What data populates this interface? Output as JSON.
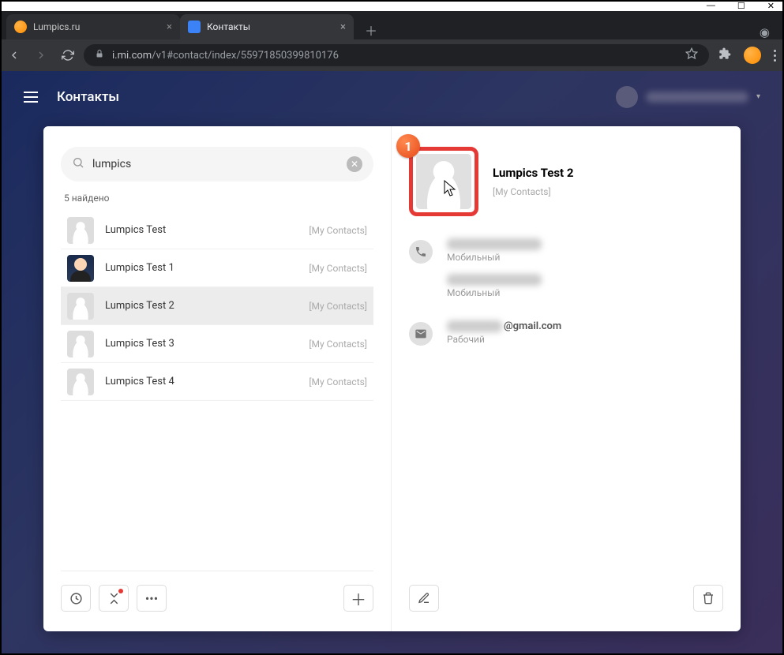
{
  "window": {
    "tabs": [
      {
        "title": "Lumpics.ru",
        "favicon": "orange",
        "active": false
      },
      {
        "title": "Контакты",
        "favicon": "blue",
        "active": true
      }
    ]
  },
  "urlbar": {
    "lock": "🔒",
    "host": "i.mi.com",
    "path": "/v1#contact/index/55971850399810176"
  },
  "app": {
    "title": "Контакты",
    "search_value": "lumpics",
    "found_label": "5 найдено",
    "contacts": [
      {
        "name": "Lumpics Test",
        "tag": "[My Contacts]",
        "avatar": "ph",
        "selected": false
      },
      {
        "name": "Lumpics Test 1",
        "tag": "[My Contacts]",
        "avatar": "dark",
        "selected": false
      },
      {
        "name": "Lumpics Test 2",
        "tag": "[My Contacts]",
        "avatar": "ph",
        "selected": true
      },
      {
        "name": "Lumpics Test 3",
        "tag": "[My Contacts]",
        "avatar": "ph",
        "selected": false
      },
      {
        "name": "Lumpics Test 4",
        "tag": "[My Contacts]",
        "avatar": "ph",
        "selected": false
      }
    ],
    "detail": {
      "name": "Lumpics Test 2",
      "tag": "[My Contacts]",
      "phone_label": "Мобильный",
      "email_suffix": "@gmail.com",
      "email_label": "Рабочий",
      "annotation_badge": "1"
    }
  }
}
